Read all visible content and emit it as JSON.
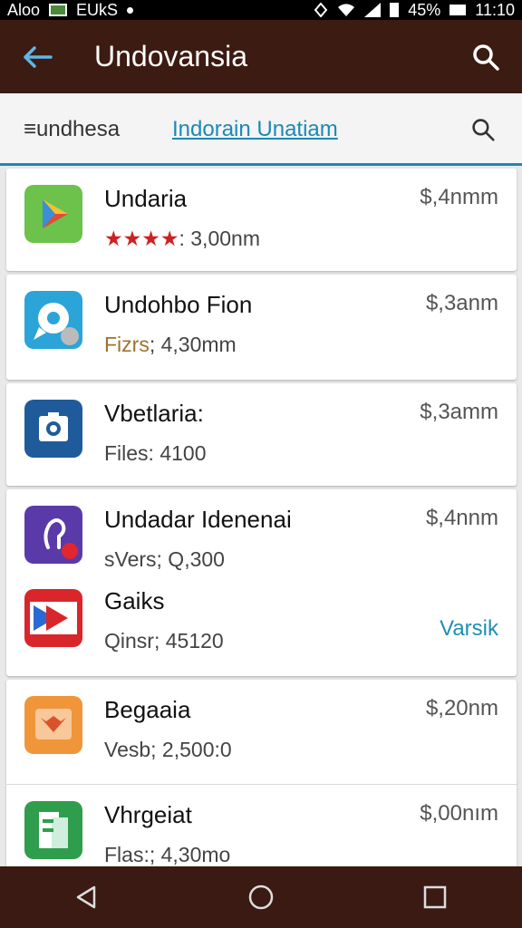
{
  "status_bar": {
    "left_text": "Aloo",
    "carrier": "EUkS",
    "battery": "45%",
    "time": "11:10"
  },
  "app_bar": {
    "title": "Undovansia"
  },
  "tabs": {
    "tab1": "≡undhesa",
    "tab2": "Indorain Unatiam"
  },
  "apps": [
    {
      "title": "Undaria",
      "subtitle_prefix": "★★★★",
      "subtitle": ": 3,00nm",
      "price": "$,4nmm",
      "icon": "play-triangle-icon",
      "color": "#6cc24a"
    },
    {
      "title": "Undohbo Fion",
      "subtitle_prefix": "Fizrs",
      "subtitle": "; 4,30mm",
      "price": "$,3anm",
      "icon": "chat-bubble-icon",
      "color": "#2ba4d8"
    },
    {
      "title": "Vbetlaria:",
      "subtitle": "Files: 4100",
      "price": "$,3amm",
      "icon": "camera-icon",
      "color": "#1f5b9a"
    },
    {
      "title": "Undadar Idenenai",
      "subtitle": "sVers; Q,300",
      "price": "$,4nnm",
      "icon": "audio-icon",
      "color": "#5a3aa8"
    },
    {
      "title": "Gaiks",
      "subtitle": "Qinsr; 45120",
      "action": "Varsik",
      "icon": "arrow-icon",
      "color": "#d9262b"
    },
    {
      "title": "Begaaia",
      "subtitle": "Vesb; 2,500:0",
      "price": "$,20nm",
      "icon": "cat-icon",
      "color": "#f0953a"
    },
    {
      "title": "Vhrgeiat",
      "subtitle": "Flas:; 4,30mo",
      "price": "$,00nım",
      "icon": "docs-icon",
      "color": "#2f9e4c"
    }
  ]
}
